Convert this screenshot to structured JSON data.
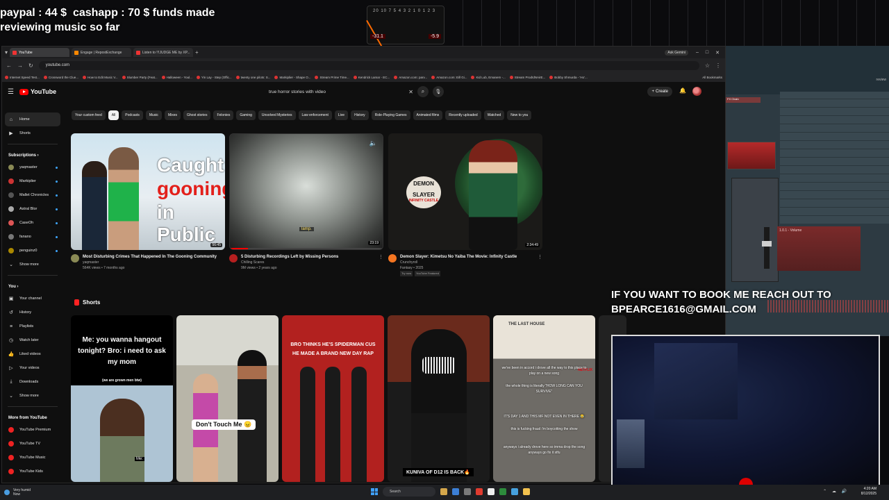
{
  "overlay": {
    "line1": "paypal : 44 $  cashapp : 70 $ funds made",
    "line2": "reviewing music so far",
    "book_line1": "IF YOU WANT TO BOOK ME REACH OUT TO",
    "book_line2": "BPEARCE1616@GMAIL.COM",
    "meter_scale": "20 10 7 5 4 3 2 1 0  1  2  3",
    "meter_left": "-31.1",
    "meter_right": "-5.9"
  },
  "browser": {
    "tabs": [
      {
        "label": "YouTube",
        "active": true
      },
      {
        "label": "Engage | RepostExchange",
        "active": false
      },
      {
        "label": "Listen to !!!JUDGE ME by XP...",
        "active": false
      }
    ],
    "new_tab": "+",
    "ask_gemini": "Ask Gemini",
    "url": "youtube.com",
    "bookmarks": [
      "Internet Speed Test...",
      "Crossword the Clue...",
      "How to Edit Music V...",
      "Slumber Party (Feat...",
      "Halloween - Youl...",
      "Yin Lay - Step (Offic...",
      "twenty one pilots: S...",
      "Markiplier - Shape O...",
      "Stream Prime Time...",
      "Kendrick Lamar - EC...",
      "Amazon.com: parv...",
      "Amazon.com: Eill Gi...",
      "Kid Lub, Emanem -...",
      "Stream Prod!dNAirE...",
      "Bobby Shmurda - 'Ho'..."
    ],
    "all_bookmarks": "All Bookmarks"
  },
  "youtube": {
    "logo": "YouTube",
    "search_value": "true horror stories with video",
    "create_label": "Create",
    "sidebar": {
      "main": [
        {
          "label": "Home",
          "icon": "home-icon"
        },
        {
          "label": "Shorts",
          "icon": "shorts-icon"
        }
      ],
      "subscriptions_title": "Subscriptions",
      "subscriptions": [
        "yaqmaster",
        "Markiplier",
        "Mallet Chronicles",
        "Astral Blor",
        "CaseOh",
        "fanano",
        "penguinz0"
      ],
      "show_more": "Show more",
      "you_title": "You",
      "you_items": [
        "Your channel",
        "History",
        "Playlists",
        "Watch later",
        "Liked videos",
        "Your videos",
        "Downloads"
      ],
      "show_more_2": "Show more",
      "more_title": "More from YouTube",
      "more_items": [
        "YouTube Premium",
        "YouTube TV",
        "YouTube Music",
        "YouTube Kids"
      ]
    },
    "chips": [
      "Your custom feed",
      "All",
      "Podcasts",
      "Music",
      "Mixes",
      "Ghost stories",
      "Felonies",
      "Gaming",
      "Unsolved Mysteries",
      "Law enforcement",
      "Live",
      "History",
      "Role-Playing Games",
      "Animated films",
      "Recently uploaded",
      "Watched",
      "New to you"
    ],
    "videos": [
      {
        "title": "Most Disturbing Crimes That Happened In The Gooning Community",
        "channel": "yaqmaster",
        "meta": "564K views • 7 months ago",
        "duration": "56:45",
        "thumb_text_1": "Caught",
        "thumb_text_2": "gooning",
        "thumb_text_3": "in Public"
      },
      {
        "title": "5 Disturbing Recordings Left by Missing Persons",
        "channel": "Chilling Scares",
        "meta": "9M views • 2 years ago",
        "duration": "23:19",
        "caption": "lamp."
      },
      {
        "title": "Demon Slayer: Kimetsu No Yaiba The Movie: Infinity Castle",
        "channel": "Crunchyroll",
        "meta": "Fantasy • 2025",
        "duration": "2:34:49",
        "badge_1": "Try now",
        "badge_2": "YouTube Featured",
        "logo_line1": "DEMON",
        "logo_line2": "SLAYER",
        "logo_line3": "INFINITY CASTLE"
      }
    ],
    "shorts_title": "Shorts",
    "shorts": [
      {
        "text": "Me: you wanna hangout tonight? Bro: i need to ask my mom",
        "sub": "(we are grown men btw)",
        "tag": "Me:"
      },
      {
        "text": "Don't Touch Me 😠"
      },
      {
        "text": "BRO THINKS HE'S SPIDERMAN CUS HE MADE A BRAND NEW DAY RAP"
      },
      {
        "text": "KUNIVA OF D12 IS BACK🔥"
      },
      {
        "house": "THE LAST HOUSE",
        "text1": "we've been in accord i drove all the way to this place to play on a new song",
        "text2": "the whole thing is literally \"HOW LONG CAN YOU SURVIVE\"",
        "text3": "IT'S DAY 1 AND THIS MF NOT EVEN IN THERE 😂",
        "text4": "this is fucking fraud i'm boycotting the show",
        "text5": "anyways i already drove here so imma drop the song anyways go fix it stfu",
        "netflix": "NETFLIX"
      }
    ]
  },
  "daw": {
    "title": "review",
    "tag": "FX Chain",
    "volume_label": "1.0.1 - Volume"
  },
  "taskbar": {
    "weather_line1": "Very humid",
    "weather_line2": "Now",
    "search": "Search",
    "time": "4:20 AM",
    "date": "8/12/2025"
  }
}
